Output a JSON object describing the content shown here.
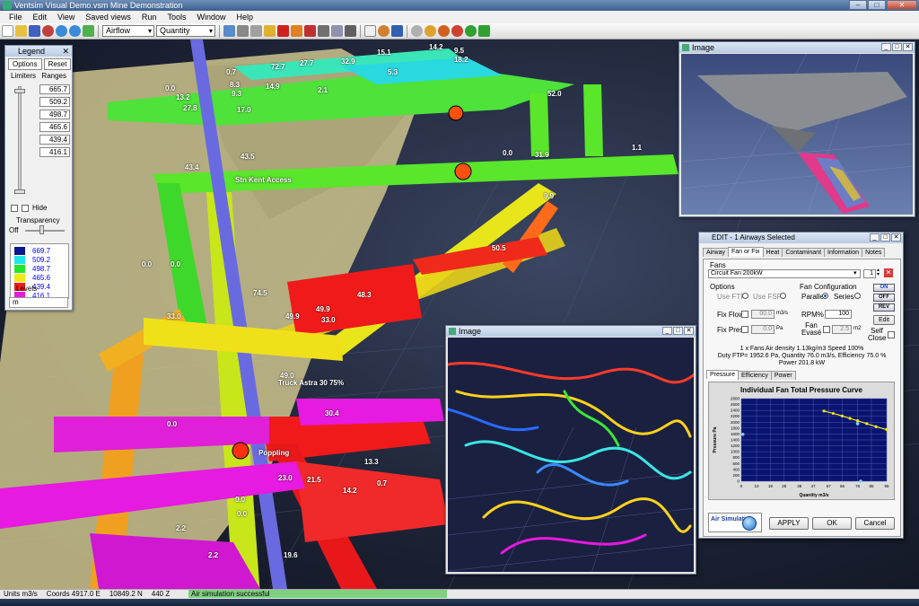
{
  "window": {
    "title": "Ventsim Visual   Demo.vsm    Mine Demonstration",
    "minimize": "–",
    "maximize": "□",
    "close": "✕"
  },
  "menu": [
    "File",
    "Edit",
    "View",
    "Saved views",
    "Run",
    "Tools",
    "Window",
    "Help"
  ],
  "toolbar": {
    "view_select": "Airflow",
    "data_select": "Quantity"
  },
  "legend": {
    "title": "Legend",
    "close": "✕",
    "options_label": "Options",
    "reset_label": "Reset",
    "limiters_label": "Limiters",
    "ranges_label": "Ranges",
    "range_values": [
      "665.7",
      "509.2",
      "498.7",
      "465.6",
      "439.4",
      "416.1"
    ],
    "hide_label": "Hide",
    "transparency_label": "Transparency",
    "off_label": "Off",
    "swatches": [
      {
        "color": "#0a1a8c",
        "value": "669.7"
      },
      {
        "color": "#22e6e6",
        "value": "509.2"
      },
      {
        "color": "#22e62a",
        "value": "498.7"
      },
      {
        "color": "#f0ea1a",
        "value": "465.6"
      },
      {
        "color": "#f01a1a",
        "value": "439.4"
      },
      {
        "color": "#e61ae0",
        "value": "416.1"
      }
    ],
    "levels_label": "Levels",
    "units_label": "m"
  },
  "image_top": {
    "title": "Image",
    "wb": [
      "_",
      "□",
      "✕"
    ]
  },
  "image_bottom": {
    "title": "Image",
    "wb": [
      "_",
      "□",
      "✕"
    ]
  },
  "edit": {
    "title": "EDIT - 1 Airways Selected",
    "wb": [
      "_",
      "□",
      "✕"
    ],
    "tabs": [
      "Airway",
      "Fan or Fix",
      "Heat",
      "Contaminant",
      "Information",
      "Notes"
    ],
    "fans_label": "Fans",
    "fan_select": "Circuit Fan 200kW",
    "fan_count": "1",
    "options_label": "Options",
    "use_ftp": "Use FTP",
    "use_fsp": "Use FSP",
    "fix_flow": "Fix Flow",
    "fix_flow_value": "00.0",
    "fix_flow_unit": "m3/s",
    "fix_press": "Fix Press",
    "fix_press_value": "0.0",
    "fix_press_unit": "Pa",
    "fan_config_label": "Fan Configuration",
    "parallel": "Parallel",
    "series": "Series",
    "rpm_label": "RPM%",
    "rpm_value": "100",
    "fan_evase": "Fan Evasé",
    "evase_value": "2.5",
    "evase_unit": "m2",
    "self_close": "Self Close",
    "btn_on": "ON",
    "btn_off": "OFF",
    "btn_rev": "REV",
    "btn_edit": "Edit",
    "summary1": "1 x Fans   Air density 1.13kg/m3  Speed 100%",
    "summary2": "Duty FTP= 1952.6 Pa, Quantity 76.0 m3/s, Efficiency 75.0 %",
    "summary3": "Power 201.8 kW",
    "chart_tabs": [
      "Pressure",
      "Efficiency",
      "Power"
    ],
    "air_sim": "Air Simulation",
    "apply": "APPLY",
    "ok": "OK",
    "cancel": "Cancel"
  },
  "chart_data": {
    "type": "line",
    "title": "Individual Fan Total Pressure Curve",
    "xlabel": "Quantity m3/s",
    "ylabel": "Pressure Pa",
    "x_ticks": [
      "0",
      "10",
      "19",
      "28",
      "38",
      "47",
      "57",
      "66",
      "76",
      "85",
      "95"
    ],
    "y_ticks": [
      "0",
      "200",
      "400",
      "600",
      "800",
      "1000",
      "1200",
      "1400",
      "1600",
      "1800",
      "2000",
      "2200",
      "2400",
      "2600",
      "2800"
    ],
    "xlim": [
      0,
      95
    ],
    "ylim": [
      0,
      2800
    ],
    "series": [
      {
        "x": [
          54,
          60,
          66,
          71,
          76,
          82,
          88,
          95
        ],
        "y": [
          2380,
          2300,
          2210,
          2130,
          2050,
          1950,
          1850,
          1750
        ]
      }
    ],
    "markers": [
      {
        "x": 1,
        "y": 1590
      },
      {
        "x": 76,
        "y": 1952
      },
      {
        "x": 78,
        "y": 0
      }
    ]
  },
  "status": {
    "units": "Units  m3/s",
    "coords": "Coords 4917.0 E",
    "north": "10849.2 N",
    "z": "440 Z",
    "message": "Air simulation successful"
  },
  "viewport_labels": [
    {
      "text": "0.0"
    },
    {
      "text": "13.2"
    },
    {
      "text": "72.7"
    },
    {
      "text": "27.7"
    },
    {
      "text": "32.9"
    },
    {
      "text": "15.1"
    },
    {
      "text": "14.2"
    },
    {
      "text": "9.5"
    },
    {
      "text": "18.2"
    },
    {
      "text": "0.7"
    },
    {
      "text": "8.3"
    },
    {
      "text": "14.9"
    },
    {
      "text": "9.3"
    },
    {
      "text": "5.3"
    },
    {
      "text": "2.1"
    },
    {
      "text": "27.8"
    },
    {
      "text": "17.0"
    },
    {
      "text": "52.0"
    },
    {
      "text": "43.5"
    },
    {
      "text": "0.0"
    },
    {
      "text": "31.9"
    },
    {
      "text": "1.1"
    },
    {
      "text": "43.4"
    },
    {
      "text": "9.9"
    },
    {
      "text": "50.5"
    },
    {
      "text": "0.0"
    },
    {
      "text": "0.0"
    },
    {
      "text": "74.5"
    },
    {
      "text": "49.9"
    },
    {
      "text": "49.9"
    },
    {
      "text": "33.0"
    },
    {
      "text": "33.0"
    },
    {
      "text": "48.3"
    },
    {
      "text": "49.0"
    },
    {
      "text": "30.4"
    },
    {
      "text": "0.0"
    },
    {
      "text": "13.3"
    },
    {
      "text": "23.0"
    },
    {
      "text": "21.5"
    },
    {
      "text": "14.2"
    },
    {
      "text": "0.7"
    },
    {
      "text": "0.0"
    },
    {
      "text": "2.2"
    },
    {
      "text": "2.2"
    },
    {
      "text": "19.6"
    },
    {
      "text": "0.0"
    },
    {
      "text": "Truck Astra 30 75%"
    },
    {
      "text": "Stn Kent Access"
    },
    {
      "text": "Poppling"
    }
  ]
}
